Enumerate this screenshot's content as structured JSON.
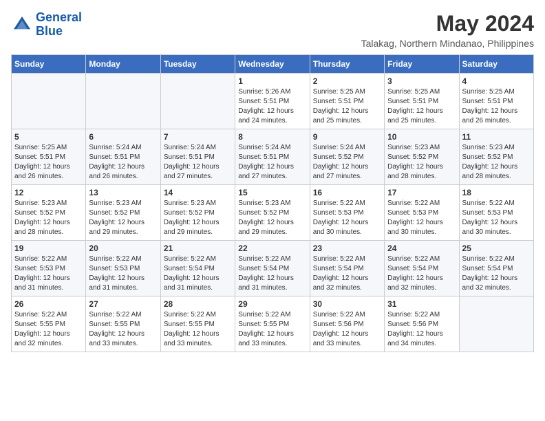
{
  "logo": {
    "line1": "General",
    "line2": "Blue"
  },
  "title": {
    "month_year": "May 2024",
    "location": "Talakag, Northern Mindanao, Philippines"
  },
  "weekdays": [
    "Sunday",
    "Monday",
    "Tuesday",
    "Wednesday",
    "Thursday",
    "Friday",
    "Saturday"
  ],
  "weeks": [
    [
      {
        "day": "",
        "info": ""
      },
      {
        "day": "",
        "info": ""
      },
      {
        "day": "",
        "info": ""
      },
      {
        "day": "1",
        "info": "Sunrise: 5:26 AM\nSunset: 5:51 PM\nDaylight: 12 hours\nand 24 minutes."
      },
      {
        "day": "2",
        "info": "Sunrise: 5:25 AM\nSunset: 5:51 PM\nDaylight: 12 hours\nand 25 minutes."
      },
      {
        "day": "3",
        "info": "Sunrise: 5:25 AM\nSunset: 5:51 PM\nDaylight: 12 hours\nand 25 minutes."
      },
      {
        "day": "4",
        "info": "Sunrise: 5:25 AM\nSunset: 5:51 PM\nDaylight: 12 hours\nand 26 minutes."
      }
    ],
    [
      {
        "day": "5",
        "info": "Sunrise: 5:25 AM\nSunset: 5:51 PM\nDaylight: 12 hours\nand 26 minutes."
      },
      {
        "day": "6",
        "info": "Sunrise: 5:24 AM\nSunset: 5:51 PM\nDaylight: 12 hours\nand 26 minutes."
      },
      {
        "day": "7",
        "info": "Sunrise: 5:24 AM\nSunset: 5:51 PM\nDaylight: 12 hours\nand 27 minutes."
      },
      {
        "day": "8",
        "info": "Sunrise: 5:24 AM\nSunset: 5:51 PM\nDaylight: 12 hours\nand 27 minutes."
      },
      {
        "day": "9",
        "info": "Sunrise: 5:24 AM\nSunset: 5:52 PM\nDaylight: 12 hours\nand 27 minutes."
      },
      {
        "day": "10",
        "info": "Sunrise: 5:23 AM\nSunset: 5:52 PM\nDaylight: 12 hours\nand 28 minutes."
      },
      {
        "day": "11",
        "info": "Sunrise: 5:23 AM\nSunset: 5:52 PM\nDaylight: 12 hours\nand 28 minutes."
      }
    ],
    [
      {
        "day": "12",
        "info": "Sunrise: 5:23 AM\nSunset: 5:52 PM\nDaylight: 12 hours\nand 28 minutes."
      },
      {
        "day": "13",
        "info": "Sunrise: 5:23 AM\nSunset: 5:52 PM\nDaylight: 12 hours\nand 29 minutes."
      },
      {
        "day": "14",
        "info": "Sunrise: 5:23 AM\nSunset: 5:52 PM\nDaylight: 12 hours\nand 29 minutes."
      },
      {
        "day": "15",
        "info": "Sunrise: 5:23 AM\nSunset: 5:52 PM\nDaylight: 12 hours\nand 29 minutes."
      },
      {
        "day": "16",
        "info": "Sunrise: 5:22 AM\nSunset: 5:53 PM\nDaylight: 12 hours\nand 30 minutes."
      },
      {
        "day": "17",
        "info": "Sunrise: 5:22 AM\nSunset: 5:53 PM\nDaylight: 12 hours\nand 30 minutes."
      },
      {
        "day": "18",
        "info": "Sunrise: 5:22 AM\nSunset: 5:53 PM\nDaylight: 12 hours\nand 30 minutes."
      }
    ],
    [
      {
        "day": "19",
        "info": "Sunrise: 5:22 AM\nSunset: 5:53 PM\nDaylight: 12 hours\nand 31 minutes."
      },
      {
        "day": "20",
        "info": "Sunrise: 5:22 AM\nSunset: 5:53 PM\nDaylight: 12 hours\nand 31 minutes."
      },
      {
        "day": "21",
        "info": "Sunrise: 5:22 AM\nSunset: 5:54 PM\nDaylight: 12 hours\nand 31 minutes."
      },
      {
        "day": "22",
        "info": "Sunrise: 5:22 AM\nSunset: 5:54 PM\nDaylight: 12 hours\nand 31 minutes."
      },
      {
        "day": "23",
        "info": "Sunrise: 5:22 AM\nSunset: 5:54 PM\nDaylight: 12 hours\nand 32 minutes."
      },
      {
        "day": "24",
        "info": "Sunrise: 5:22 AM\nSunset: 5:54 PM\nDaylight: 12 hours\nand 32 minutes."
      },
      {
        "day": "25",
        "info": "Sunrise: 5:22 AM\nSunset: 5:54 PM\nDaylight: 12 hours\nand 32 minutes."
      }
    ],
    [
      {
        "day": "26",
        "info": "Sunrise: 5:22 AM\nSunset: 5:55 PM\nDaylight: 12 hours\nand 32 minutes."
      },
      {
        "day": "27",
        "info": "Sunrise: 5:22 AM\nSunset: 5:55 PM\nDaylight: 12 hours\nand 33 minutes."
      },
      {
        "day": "28",
        "info": "Sunrise: 5:22 AM\nSunset: 5:55 PM\nDaylight: 12 hours\nand 33 minutes."
      },
      {
        "day": "29",
        "info": "Sunrise: 5:22 AM\nSunset: 5:55 PM\nDaylight: 12 hours\nand 33 minutes."
      },
      {
        "day": "30",
        "info": "Sunrise: 5:22 AM\nSunset: 5:56 PM\nDaylight: 12 hours\nand 33 minutes."
      },
      {
        "day": "31",
        "info": "Sunrise: 5:22 AM\nSunset: 5:56 PM\nDaylight: 12 hours\nand 34 minutes."
      },
      {
        "day": "",
        "info": ""
      }
    ]
  ]
}
